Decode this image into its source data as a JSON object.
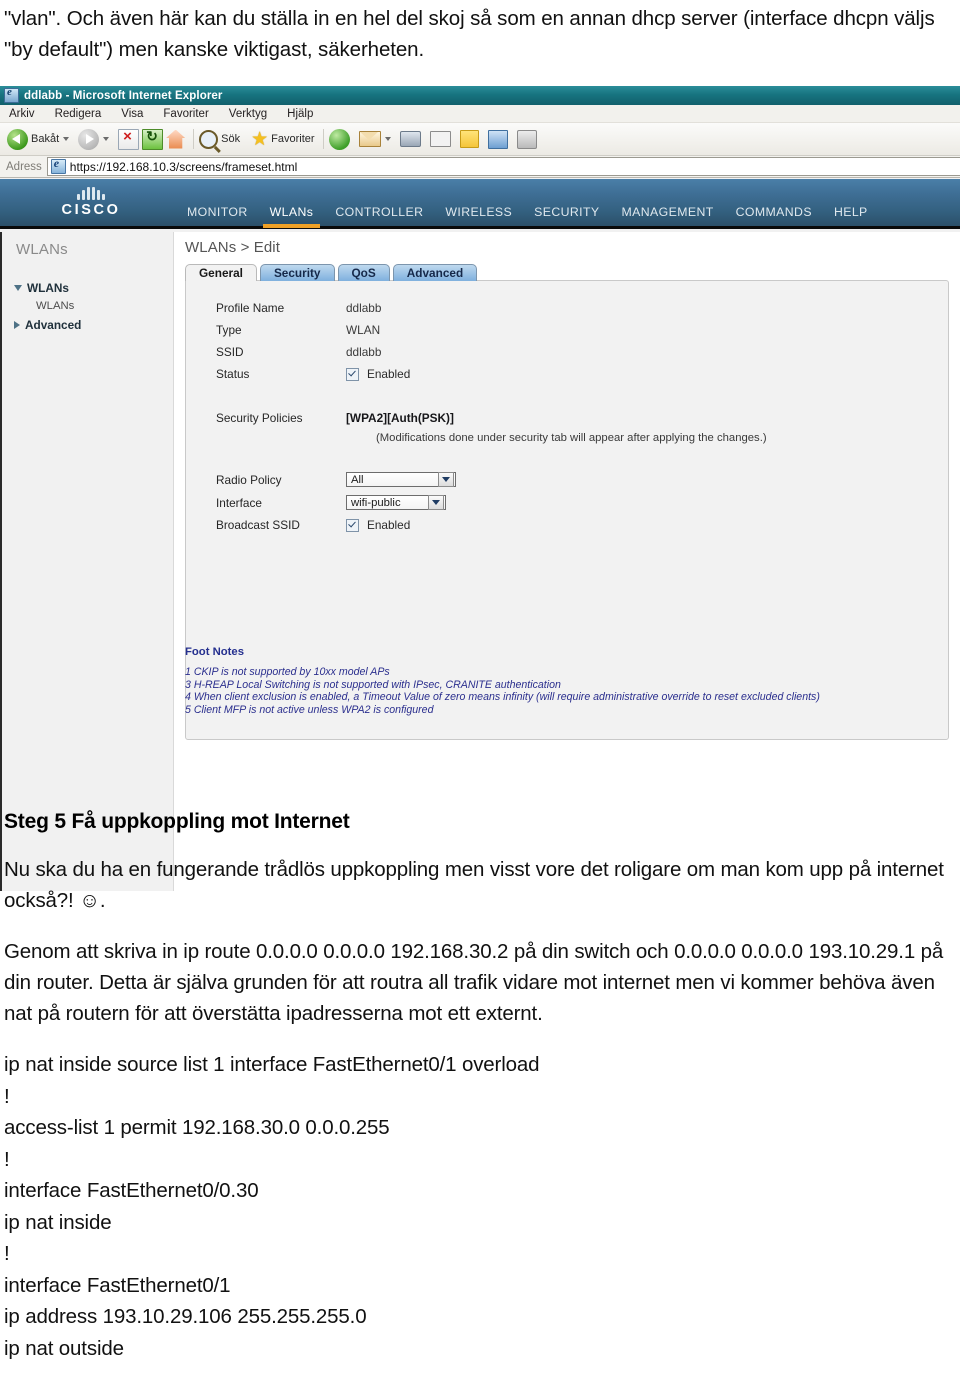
{
  "document": {
    "intro_paragraph": "\"vlan\". Och även här kan du ställa in en hel del skoj så som en annan dhcp server (interface dhcpn väljs \"by default\") men kanske viktigast, säkerheten.",
    "step_heading": "Steg 5 Få uppkoppling mot Internet",
    "paragraph_1": "Nu ska du ha en fungerande trådlös uppkoppling men visst vore det roligare om man kom upp på internet också?! ☺.",
    "paragraph_2": "Genom att skriva in ip route 0.0.0.0 0.0.0.0 192.168.30.2 på din switch och 0.0.0.0 0.0.0.0 193.10.29.1 på din router. Detta är själva grunden för att routra all trafik vidare mot internet men vi kommer behöva även nat på routern för att överstätta ipadresserna mot ett externt.",
    "config_lines": [
      "ip nat inside source list 1 interface FastEthernet0/1 overload",
      "!",
      "access-list 1 permit 192.168.30.0 0.0.0.255",
      "!",
      "interface FastEthernet0/0.30",
      "ip nat inside",
      "!",
      "interface FastEthernet0/1",
      "ip address 193.10.29.106 255.255.255.0",
      "ip nat outside"
    ]
  },
  "browser": {
    "window_title": "ddlabb - Microsoft Internet Explorer",
    "menu_items": [
      "Arkiv",
      "Redigera",
      "Visa",
      "Favoriter",
      "Verktyg",
      "Hjälp"
    ],
    "toolbar": {
      "back_label": "Bakåt",
      "search_label": "Sök",
      "favorites_label": "Favoriter"
    },
    "address": {
      "label": "Adress",
      "url": "https://192.168.10.3/screens/frameset.html"
    }
  },
  "wlc": {
    "brand": "CISCO",
    "nav": [
      {
        "label": "MONITOR",
        "active": false
      },
      {
        "label": "WLANs",
        "active": true
      },
      {
        "label": "CONTROLLER",
        "active": false
      },
      {
        "label": "WIRELESS",
        "active": false
      },
      {
        "label": "SECURITY",
        "active": false
      },
      {
        "label": "MANAGEMENT",
        "active": false
      },
      {
        "label": "COMMANDS",
        "active": false
      },
      {
        "label": "HELP",
        "active": false
      }
    ],
    "sidebar": {
      "title": "WLANs",
      "items": [
        {
          "label": "WLANs",
          "type": "group-expanded"
        },
        {
          "label": "WLANs",
          "type": "leaf"
        },
        {
          "label": "Advanced",
          "type": "group-collapsed"
        }
      ]
    },
    "breadcrumb": "WLANs > Edit",
    "tabs": [
      {
        "label": "General",
        "active": true
      },
      {
        "label": "Security",
        "active": false
      },
      {
        "label": "QoS",
        "active": false
      },
      {
        "label": "Advanced",
        "active": false
      }
    ],
    "general": {
      "profile_name_label": "Profile Name",
      "profile_name_value": "ddlabb",
      "type_label": "Type",
      "type_value": "WLAN",
      "ssid_label": "SSID",
      "ssid_value": "ddlabb",
      "status_label": "Status",
      "status_checkbox_label": "Enabled",
      "security_policies_label": "Security Policies",
      "security_policies_value": "[WPA2][Auth(PSK)]",
      "security_note": "(Modifications done under security tab will appear after applying the changes.)",
      "radio_policy_label": "Radio Policy",
      "radio_policy_value": "All",
      "interface_label": "Interface",
      "interface_value": "wifi-public",
      "broadcast_ssid_label": "Broadcast SSID",
      "broadcast_ssid_checkbox_label": "Enabled"
    },
    "footnotes": {
      "title": "Foot Notes",
      "lines": [
        "1 CKIP is not supported by 10xx model APs",
        "3 H-REAP Local Switching is not supported with IPsec, CRANITE authentication",
        "4 When client exclusion is enabled, a Timeout Value of zero means infinity (will require administrative override to reset excluded clients)",
        "5 Client MFP is not active unless WPA2 is configured"
      ]
    }
  },
  "colors": {
    "title_bar": "#177480",
    "cisco_header": "#3f6f96",
    "active_tab_underline": "#f0a126",
    "footnote_text": "#2b2f8e"
  }
}
